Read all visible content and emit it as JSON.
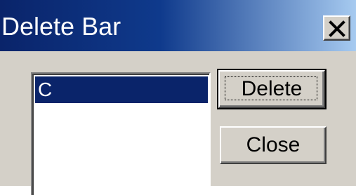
{
  "window": {
    "title": "Delete Bar",
    "close_icon": "close-x-icon"
  },
  "list": {
    "items": [
      "C"
    ],
    "selected_index": 0,
    "selection_color": "#0a246a"
  },
  "buttons": {
    "delete_label": "Delete",
    "close_label": "Close"
  },
  "colors": {
    "title_gradient_start": "#0a246a",
    "title_gradient_end": "#a6caf0",
    "face": "#d4d0c8"
  }
}
